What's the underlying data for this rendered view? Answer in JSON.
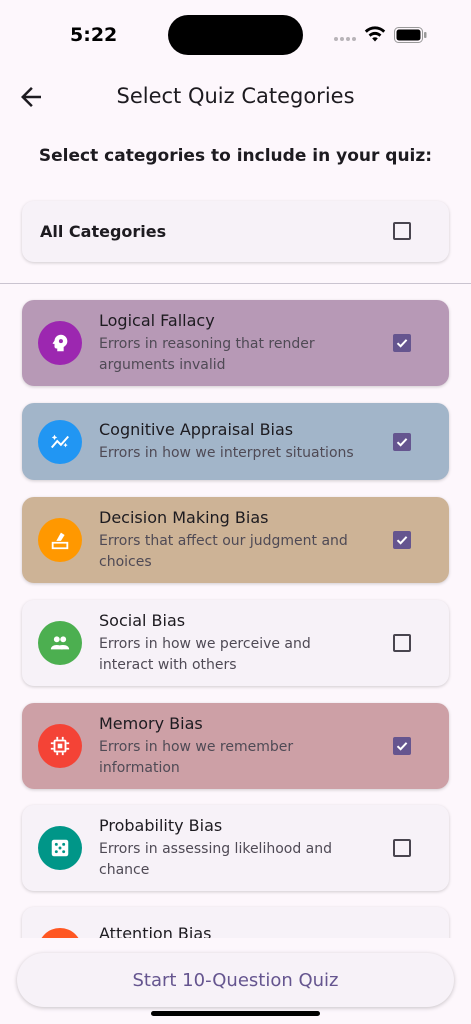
{
  "status": {
    "time": "5:22"
  },
  "header": {
    "title": "Select Quiz Categories"
  },
  "instruction": "Select categories to include in your quiz:",
  "all_categories": {
    "label": "All Categories",
    "checked": false
  },
  "categories": [
    {
      "title": "Logical Fallacy",
      "desc": "Errors in reasoning that render arguments invalid",
      "checked": true,
      "icon": "psychology-icon",
      "icon_color": "#9c27b0",
      "card_color": "#b799b6"
    },
    {
      "title": "Cognitive Appraisal Bias",
      "desc": "Errors in how we interpret situations",
      "checked": true,
      "icon": "auto-graph-icon",
      "icon_color": "#2196f3",
      "card_color": "#a2b5c9"
    },
    {
      "title": "Decision Making Bias",
      "desc": "Errors that affect our judgment and choices",
      "checked": true,
      "icon": "ballot-icon",
      "icon_color": "#ff9800",
      "card_color": "#cdb396"
    },
    {
      "title": "Social Bias",
      "desc": "Errors in how we perceive and interact with others",
      "checked": false,
      "icon": "people-icon",
      "icon_color": "#4caf50",
      "card_color": "#f7f2f8"
    },
    {
      "title": "Memory Bias",
      "desc": "Errors in how we remember information",
      "checked": true,
      "icon": "memory-icon",
      "icon_color": "#f44336",
      "card_color": "#cda0a6"
    },
    {
      "title": "Probability Bias",
      "desc": "Errors in assessing likelihood and chance",
      "checked": false,
      "icon": "dice-icon",
      "icon_color": "#009688",
      "card_color": "#f7f2f8"
    },
    {
      "title": "Attention Bias",
      "desc": "",
      "checked": false,
      "icon": "visibility-icon",
      "icon_color": "#ff5722",
      "card_color": "#f7f2f8"
    }
  ],
  "start_button": {
    "label": "Start 10-Question Quiz"
  },
  "colors": {
    "accent": "#65558f",
    "background": "#fdf7fc"
  }
}
